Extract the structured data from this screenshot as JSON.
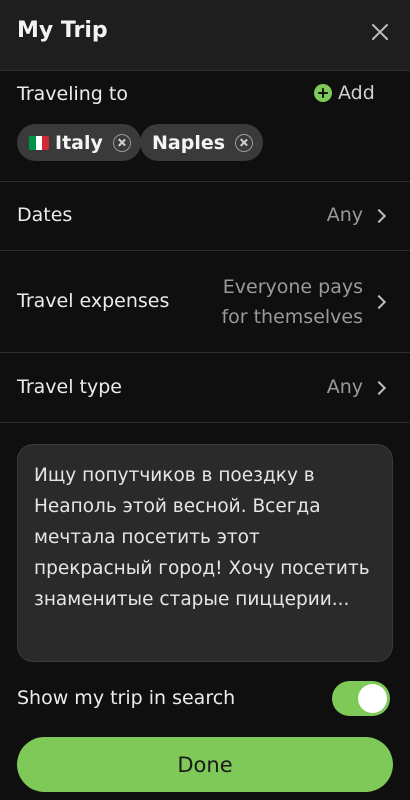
{
  "header": {
    "title": "My Trip"
  },
  "destinations": {
    "label": "Traveling to",
    "add_label": "Add",
    "chips": [
      {
        "label": "Italy",
        "flag": [
          "#009246",
          "#ffffff",
          "#ce2b37"
        ]
      },
      {
        "label": "Naples"
      }
    ]
  },
  "rows": {
    "dates": {
      "label": "Dates",
      "value": "Any"
    },
    "expenses": {
      "label": "Travel expenses",
      "value_line1": "Everyone pays",
      "value_line2": "for themselves"
    },
    "type": {
      "label": "Travel type",
      "value": "Any"
    }
  },
  "description": "Ищу попутчиков в поездку в Неаполь этой весной. Всегда мечтала посетить этот прекрасный город! Хочу посетить знаменитые старые пиццерии...",
  "visibility": {
    "label": "Show my trip in search",
    "enabled": true
  },
  "done_label": "Done",
  "colors": {
    "accent": "#7ec957",
    "background": "#0f0f0f",
    "header": "#1e1e1e",
    "chip": "#3a3a3a"
  }
}
